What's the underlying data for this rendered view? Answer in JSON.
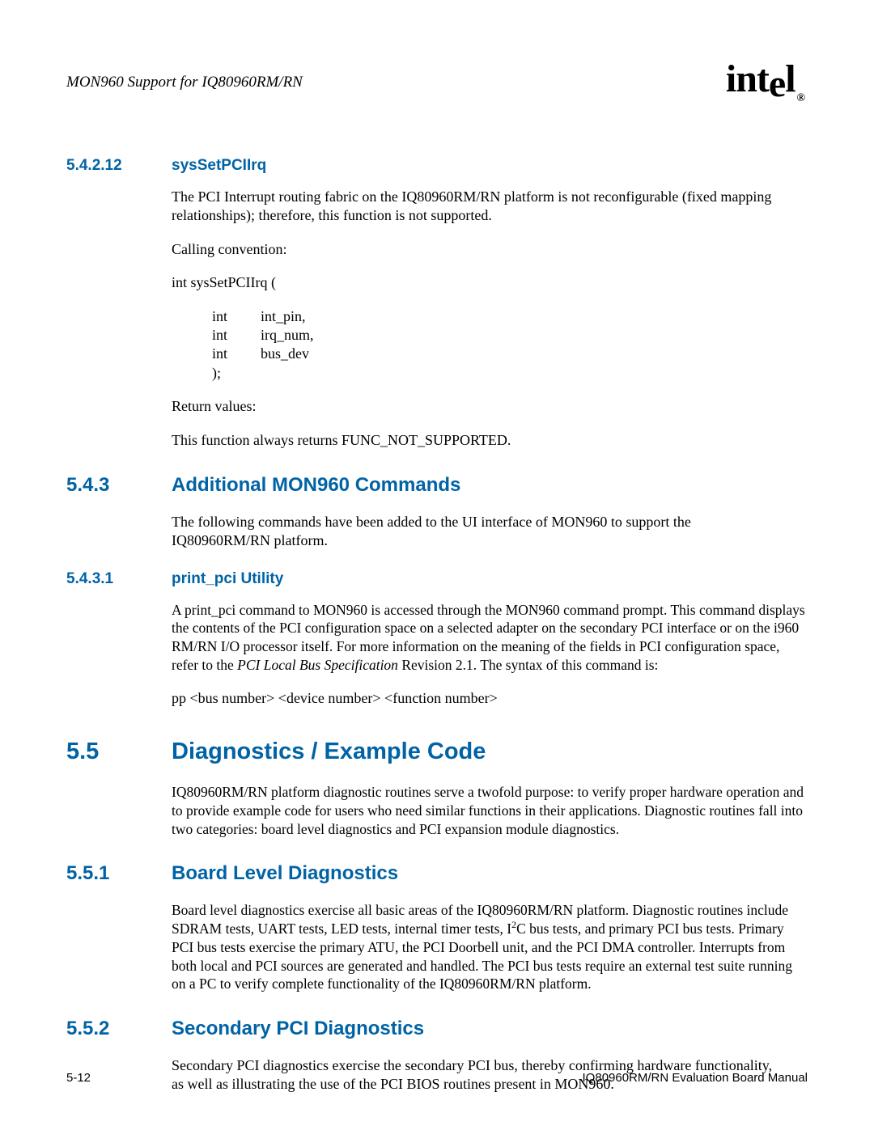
{
  "header": {
    "doc_title": "MON960 Support for IQ80960RM/RN",
    "logo_text": "int",
    "logo_sub": "e",
    "logo_sub2": "l",
    "logo_reg": "®"
  },
  "sections": {
    "s54212": {
      "num": "5.4.2.12",
      "title": "sysSetPCIIrq",
      "p1": "The PCI Interrupt routing fabric on the IQ80960RM/RN platform is not reconfigurable (fixed mapping relationships); therefore, this function is not supported.",
      "p2": "Calling convention:",
      "p3": "int sysSetPCIIrq (",
      "args": [
        {
          "type": "int",
          "name": "int_pin,"
        },
        {
          "type": "int",
          "name": "irq_num,"
        },
        {
          "type": "int",
          "name": "bus_dev"
        },
        {
          "type": ");",
          "name": ""
        }
      ],
      "p4": "Return values:",
      "p5": "This function always returns FUNC_NOT_SUPPORTED."
    },
    "s543": {
      "num": "5.4.3",
      "title": "Additional MON960 Commands",
      "p1": "The following commands have been added to the UI interface of MON960 to support the IQ80960RM/RN platform."
    },
    "s5431": {
      "num": "5.4.3.1",
      "title": "print_pci Utility",
      "p1_a": "A print_pci command to MON960 is accessed through the MON960 command prompt. This command displays the contents of the PCI configuration space on a selected adapter on the secondary PCI interface or on the i960 RM/RN I/O processor itself. For more information on the meaning of the fields in PCI configuration space, refer to the ",
      "p1_i": "PCI Local Bus Specification",
      "p1_b": " Revision 2.1. The syntax of this command is:",
      "p2": "pp <bus number> <device number> <function number>"
    },
    "s55": {
      "num": "5.5",
      "title": "Diagnostics / Example Code",
      "p1": "IQ80960RM/RN platform diagnostic routines serve a twofold purpose: to verify proper hardware operation and to provide example code for users who need similar functions in their applications. Diagnostic routines fall into two categories: board level diagnostics and PCI expansion module diagnostics."
    },
    "s551": {
      "num": "5.5.1",
      "title": "Board Level Diagnostics",
      "p1_a": "Board level diagnostics exercise all basic areas of the IQ80960RM/RN platform. Diagnostic routines include SDRAM tests, UART tests, LED tests, internal timer tests, I",
      "p1_sup": "2",
      "p1_b": "C bus tests, and primary PCI bus tests. Primary PCI bus tests exercise the primary ATU, the PCI Doorbell unit, and the PCI DMA controller. Interrupts from both local and PCI sources are generated and handled. The PCI bus tests require an external test suite running on a PC to verify complete functionality of the IQ80960RM/RN platform."
    },
    "s552": {
      "num": "5.5.2",
      "title": "Secondary PCI Diagnostics",
      "p1": "Secondary PCI diagnostics exercise the secondary PCI bus, thereby confirming hardware functionality, as well as illustrating the use of the PCI BIOS routines present in MON960."
    }
  },
  "footer": {
    "page_num": "5-12",
    "doc_footer": "IQ80960RM/RN Evaluation Board Manual"
  }
}
